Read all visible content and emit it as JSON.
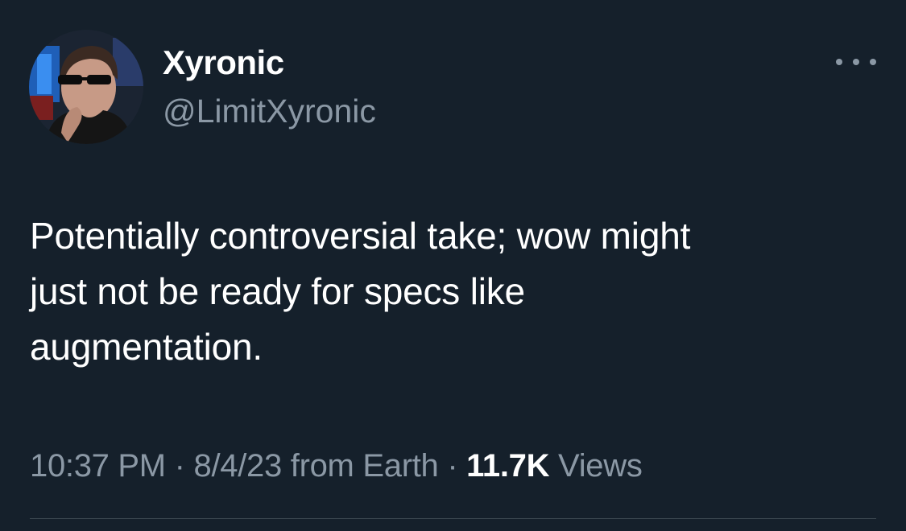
{
  "tweet": {
    "author": {
      "display_name": "Xyronic",
      "handle": "@LimitXyronic",
      "avatar": "avatar-photo"
    },
    "more_icon": "more-horizontal-icon",
    "text": "Potentially controversial take; wow might\njust not be ready for specs like\naugmentation.",
    "meta": {
      "time": "10:37 PM",
      "separator": "·",
      "date": "8/4/23",
      "source": "from Earth",
      "views_count": "11.7K",
      "views_label": "Views"
    }
  },
  "colors": {
    "background": "#15202b",
    "primary_text": "#ffffff",
    "secondary_text": "#8b98a5",
    "divider": "#38444d"
  }
}
